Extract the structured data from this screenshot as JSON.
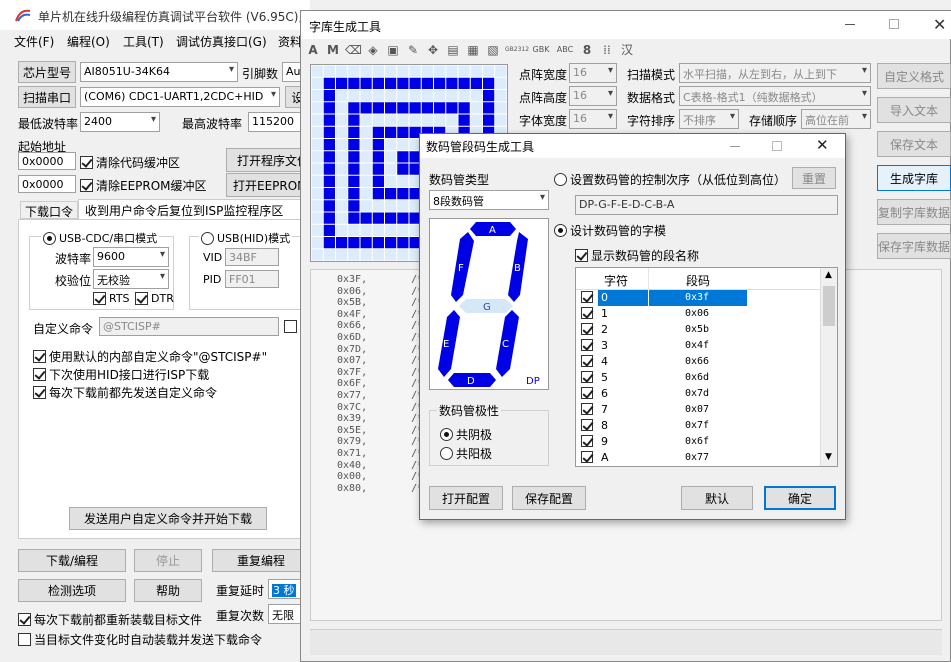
{
  "main": {
    "title": "单片机在线升级编程仿真调试平台软件 (V6.95C), 与明理科技有限公司",
    "menu": [
      "文件(F)",
      "编程(O)",
      "工具(T)",
      "调试仿真接口(G)",
      "资料"
    ],
    "chip_btn": "芯片型号",
    "chip_val": "AI8051U-34K64",
    "pin_lbl": "引脚数",
    "pin_val": "Auto",
    "scan_btn": "扫描串口",
    "port_val": "(COM6) CDC1-UART1,2CDC+HID",
    "port_btn2": "设",
    "min_baud_lbl": "最低波特率",
    "min_baud": "2400",
    "max_baud_lbl": "最高波特率",
    "max_baud": "115200",
    "start_addr_lbl": "起始地址",
    "addr1": "0x0000",
    "clr_code": "清除代码缓冲区",
    "open_prog": "打开程序文件",
    "addr2": "0x0000",
    "clr_eeprom": "清除EEPROM缓冲区",
    "open_eeprom": "打开EEPROM文件",
    "tabs": [
      "下载口令",
      "收到用户命令后复位到ISP监控程序区"
    ],
    "usb_cdc": "USB-CDC/串口模式",
    "usb_hid": "USB(HID)模式",
    "baud_lbl": "波特率",
    "baud": "9600",
    "parity_lbl": "校验位",
    "parity": "无校验",
    "vid_lbl": "VID",
    "vid": "34BF",
    "pid_lbl": "PID",
    "pid": "FF01",
    "rts": "RTS",
    "dtr": "DTR",
    "custom_lbl": "自定义命令",
    "custom_val": "@STCISP#",
    "custom_extra": "I",
    "opt1": "使用默认的内部自定义命令\"@STCISP#\"",
    "opt2": "下次使用HID接口进行ISP下载",
    "opt3": "每次下载前都先发送自定义命令",
    "send_btn": "发送用户自定义命令并开始下载",
    "dl_btn": "下载/编程",
    "stop_btn": "停止",
    "reprog_btn": "重复编程",
    "detect_btn": "检测选项",
    "help_btn": "帮助",
    "delay_lbl": "重复延时",
    "delay_val": "3 秒",
    "count_lbl": "重复次数",
    "count_val": "无限",
    "reload": "每次下载前都重新装载目标文件",
    "auto_load": "当目标文件变化时自动装载并发送下载命令"
  },
  "font": {
    "title": "字库生成工具",
    "toolbar_text": [
      "A",
      "M",
      "GB2312",
      "GBK",
      "ABC",
      "8",
      "汉"
    ],
    "width_lbl": "点阵宽度",
    "width": "16",
    "height_lbl": "点阵高度",
    "height": "16",
    "fw_lbl": "字体宽度",
    "fw": "16",
    "scan_lbl": "扫描模式",
    "scan": "水平扫描，从左到右，从上到下",
    "data_lbl": "数据格式",
    "data": "C表格-格式1（纯数据格式）",
    "order_lbl": "字符排序",
    "order": "不排序",
    "store_lbl": "存储顺序",
    "store": "高位在前",
    "btns": [
      "自定义格式",
      "导入文本",
      "保存文本",
      "生成字库",
      "复制字库数据",
      "保存字库数据"
    ],
    "code_hex": [
      "0x3F,",
      "0x06,",
      "0x5B,",
      "0x4F,",
      "0x66,",
      "0x6D,",
      "0x7D,",
      "0x07,",
      "0x7F,",
      "0x6F,",
      "0x77,",
      "0x7C,",
      "0x39,",
      "0x5E,",
      "0x79,",
      "0x71,",
      "0x40,",
      "0x00,",
      "0x80,"
    ],
    "code_cmt": "/*"
  },
  "dialog": {
    "title": "数码管段码生成工具",
    "type_lbl": "数码管类型",
    "type": "8段数码管",
    "order_radio": "设置数码管的控制次序（从低位到高位）",
    "reset_btn": "重置",
    "order_val": "DP-G-F-E-D-C-B-A",
    "design_radio": "设计数码管的字模",
    "show_names": "显示数码管的段名称",
    "seg": {
      "a": "A",
      "b": "B",
      "c": "C",
      "d": "D",
      "e": "E",
      "f": "F",
      "g": "G",
      "dp": "DP"
    },
    "polarity_lbl": "数码管极性",
    "cathode": "共阴极",
    "anode": "共阳极",
    "col_char": "字符",
    "col_code": "段码",
    "rows": [
      {
        "c": "0",
        "v": "0x3f"
      },
      {
        "c": "1",
        "v": "0x06"
      },
      {
        "c": "2",
        "v": "0x5b"
      },
      {
        "c": "3",
        "v": "0x4f"
      },
      {
        "c": "4",
        "v": "0x66"
      },
      {
        "c": "5",
        "v": "0x6d"
      },
      {
        "c": "6",
        "v": "0x7d"
      },
      {
        "c": "7",
        "v": "0x07"
      },
      {
        "c": "8",
        "v": "0x7f"
      },
      {
        "c": "9",
        "v": "0x6f"
      },
      {
        "c": "A",
        "v": "0x77"
      }
    ],
    "open_cfg": "打开配置",
    "save_cfg": "保存配置",
    "default_btn": "默认",
    "ok_btn": "确定",
    "colors": {
      "segment_on": "#0000e6",
      "segment_off": "#d6e8f8",
      "selected": "#0078d7"
    }
  }
}
